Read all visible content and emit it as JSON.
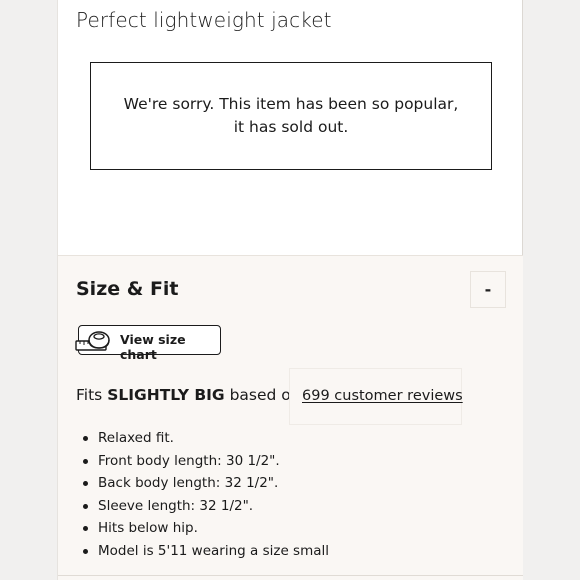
{
  "product": {
    "title": "Perfect lightweight jacket",
    "sold_out_message": "We're sorry. This item has been so popular, it has sold out."
  },
  "size_fit": {
    "heading": "Size & Fit",
    "collapse_symbol": "-",
    "size_chart_icon": "measuring-tape-icon",
    "size_chart_label": "View size chart",
    "fits_prefix": "Fits",
    "fits_value": "SLIGHTLY BIG",
    "fits_suffix": "based on",
    "reviews_link": "699 customer reviews",
    "details": [
      "Relaxed fit.",
      "Front body length: 30 1/2\".",
      "Back body length: 32 1/2\".",
      "Sleeve length: 32 1/2\".",
      "Hits below hip.",
      "Model is 5'11 wearing a size small"
    ]
  },
  "colors": {
    "page_background": "#f1f0ef",
    "panel_background": "#ffffff",
    "section_background": "#faf7f4",
    "text": "#1b1b1b"
  }
}
